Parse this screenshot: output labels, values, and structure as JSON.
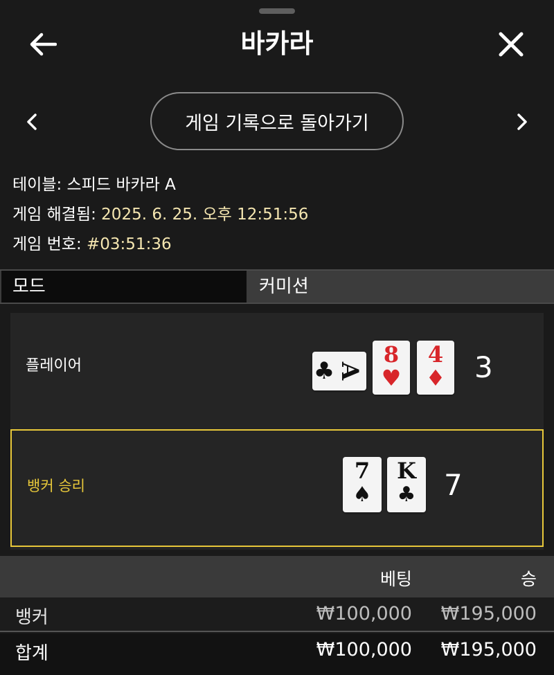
{
  "header": {
    "title": "바카라",
    "back_icon": "arrow-left-icon",
    "close_icon": "close-icon"
  },
  "nav": {
    "history_button_label": "게임 기록으로 돌아가기",
    "prev_icon": "chevron-left-icon",
    "next_icon": "chevron-right-icon"
  },
  "info": {
    "table_label": "테이블: ",
    "table_value": "스피드 바카라 A",
    "resolved_label": "게임 해결됨: ",
    "resolved_value": "2025. 6. 25. 오후 12:51:56",
    "game_no_label": "게임 번호: ",
    "game_no_value": "#03:51:36"
  },
  "mode": {
    "mode_label": "모드",
    "commission_label": "커미션"
  },
  "result": {
    "player": {
      "label": "플레이어",
      "score": "3",
      "cards": [
        {
          "rank": "A",
          "suit": "♣",
          "color": "black",
          "orientation": "sideways"
        },
        {
          "rank": "8",
          "suit": "♥",
          "color": "red",
          "orientation": "upright"
        },
        {
          "rank": "4",
          "suit": "♦",
          "color": "red",
          "orientation": "upright"
        }
      ]
    },
    "banker": {
      "label": "뱅커 승리",
      "score": "7",
      "cards": [
        {
          "rank": "7",
          "suit": "♠",
          "color": "black",
          "orientation": "upright"
        },
        {
          "rank": "K",
          "suit": "♣",
          "color": "black",
          "orientation": "upright"
        }
      ]
    },
    "highlight_color": "#e8c83a"
  },
  "bets": {
    "header_bet": "베팅",
    "header_win": "승",
    "rows": [
      {
        "label": "뱅커",
        "bet": "₩100,000",
        "win": "₩195,000"
      }
    ],
    "total": {
      "label": "합계",
      "bet": "₩100,000",
      "win": "₩195,000"
    }
  }
}
